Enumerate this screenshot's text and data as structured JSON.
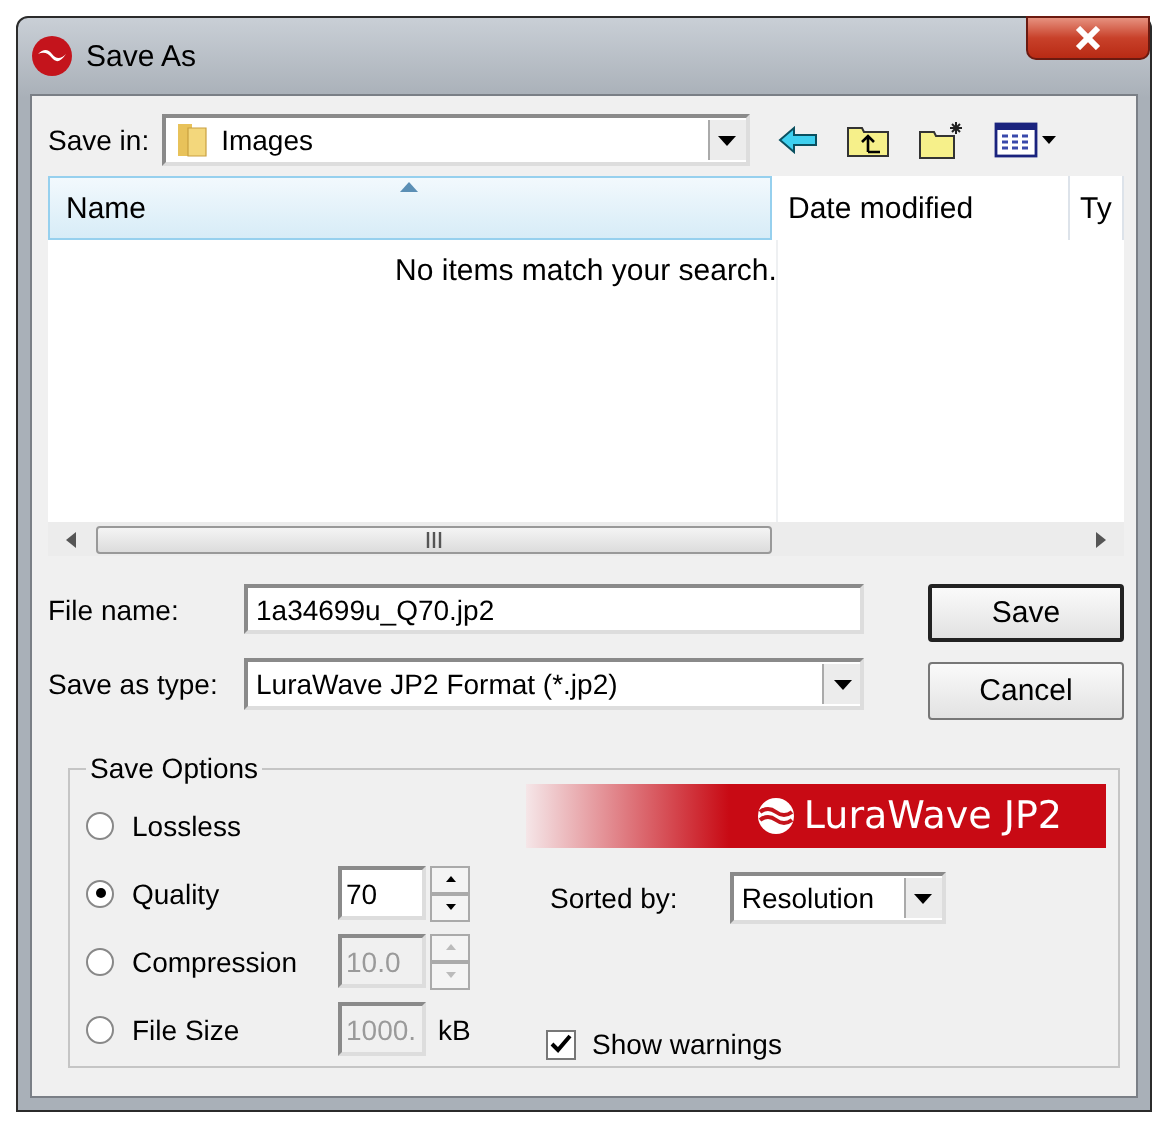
{
  "window": {
    "title": "Save As"
  },
  "save_in": {
    "label": "Save in:",
    "value": "Images"
  },
  "file_list": {
    "columns": [
      {
        "label": "Name",
        "sorted": true
      },
      {
        "label": "Date modified",
        "sorted": false
      },
      {
        "label": "Ty",
        "sorted": false
      }
    ],
    "empty_message": "No items match your search."
  },
  "file_name": {
    "label": "File name:",
    "value": "1a34699u_Q70.jp2"
  },
  "save_as_type": {
    "label": "Save as type:",
    "value": "LuraWave JP2 Format (*.jp2)"
  },
  "buttons": [
    {
      "label": "Save",
      "default": true
    },
    {
      "label": "Cancel",
      "default": false
    }
  ],
  "save_options": {
    "title": "Save Options",
    "modes": [
      {
        "label": "Lossless",
        "selected": false
      },
      {
        "label": "Quality",
        "selected": true,
        "value": "70",
        "disabled": false
      },
      {
        "label": "Compression",
        "selected": false,
        "value": "10.0",
        "disabled": true
      },
      {
        "label": "File Size",
        "selected": false,
        "value": "1000.",
        "disabled": true,
        "unit": "kB"
      }
    ],
    "logo": "LuraWave JP2",
    "sorted_by": {
      "label": "Sorted by:",
      "value": "Resolution"
    },
    "show_warnings": {
      "label": "Show warnings",
      "checked": true
    }
  }
}
